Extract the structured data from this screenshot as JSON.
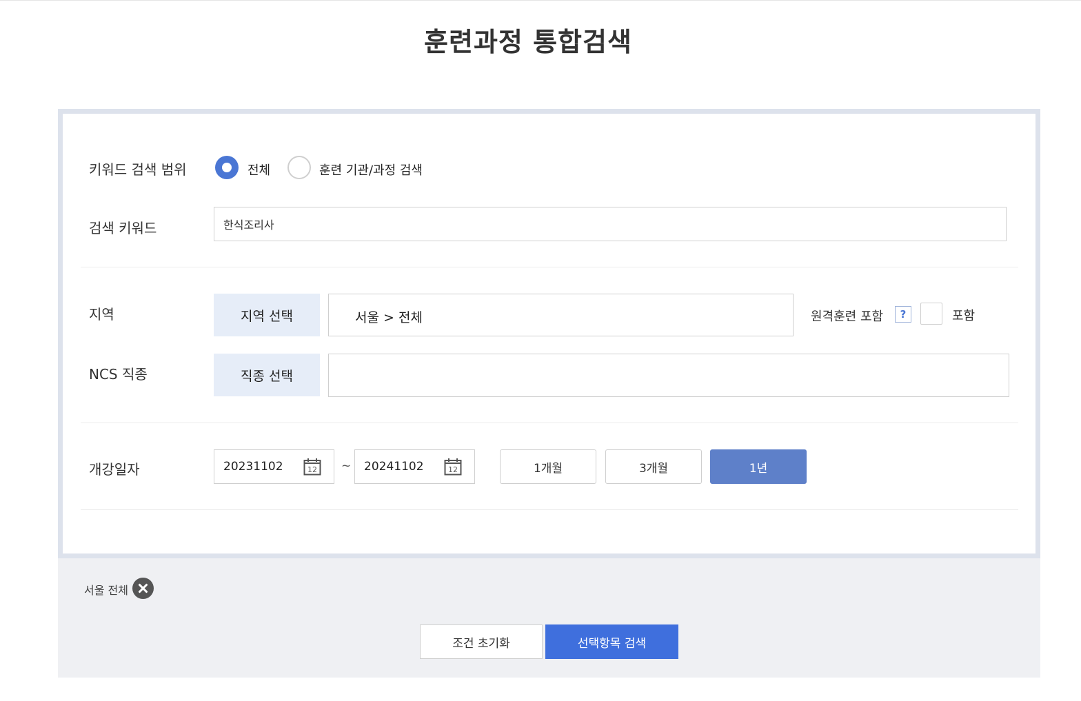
{
  "page": {
    "title": "훈련과정 통합검색"
  },
  "keyword_scope": {
    "label": "키워드 검색 범위",
    "options": [
      {
        "label": "전체",
        "selected": true
      },
      {
        "label": "훈련 기관/과정 검색",
        "selected": false
      }
    ]
  },
  "keyword": {
    "label": "검색 키워드",
    "value": "한식조리사"
  },
  "region": {
    "label": "지역",
    "button": "지역 선택",
    "value": "서울 > 전체",
    "remote_label": "원격훈련 포함",
    "help": "?",
    "include_label": "포함",
    "include_checked": false
  },
  "ncs": {
    "label": "NCS 직종",
    "button": "직종 선택",
    "value": ""
  },
  "open_date": {
    "label": "개강일자",
    "start": "20231102",
    "end": "20241102",
    "separator": "~",
    "calendar_day": "12",
    "periods": [
      {
        "label": "1개월",
        "active": false
      },
      {
        "label": "3개월",
        "active": false
      },
      {
        "label": "1년",
        "active": true
      }
    ]
  },
  "chips": [
    {
      "label": "서울 전체"
    }
  ],
  "actions": {
    "reset": "조건 초기화",
    "search": "선택항목 검색"
  },
  "colors": {
    "accent": "#3f6fdd",
    "active_period": "#5e80c9",
    "select_btn_bg": "#e6edf8",
    "frame": "#dde2ec"
  }
}
